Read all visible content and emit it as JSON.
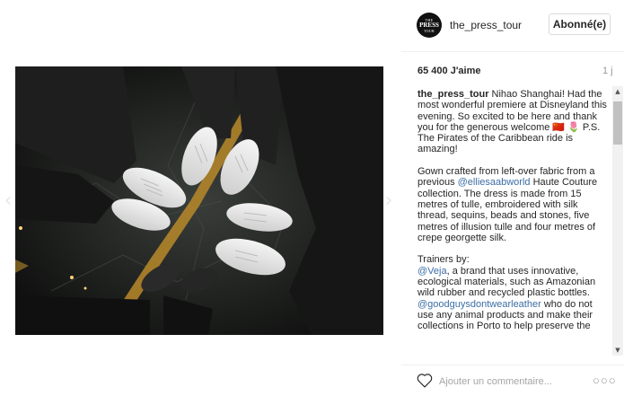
{
  "post": {
    "username": "the_press_tour",
    "follow_label": "Abonné(e)",
    "avatar_text": [
      "THE",
      "PRESS",
      "TOUR"
    ],
    "likes": "65 400 J'aime",
    "age": "1 j",
    "caption": [
      [
        {
          "t": "the_press_tour",
          "s": "user"
        },
        {
          "t": " Nihao Shanghai! Had the most wonderful premiere at Disneyland this evening. So excited to be here and thank you for the generous welcome 🇨🇳 🌷 P.S. The Pirates of the Caribbean ride is amazing!",
          "s": ""
        }
      ],
      [
        {
          "t": "Gown crafted from left-over fabric from a previous ",
          "s": ""
        },
        {
          "t": "@elliesaabworld",
          "s": "hl"
        },
        {
          "t": " Haute Couture collection. The dress is made from 15 metres of tulle, embroidered with silk thread, sequins, beads and stones, five metres of illusion tulle and four metres of crepe georgette silk.",
          "s": ""
        }
      ],
      [
        {
          "t": "Trainers by:",
          "s": "",
          "br": true
        },
        {
          "t": "@Veja",
          "s": "hl"
        },
        {
          "t": ", a brand that uses innovative, ecological materials, such as Amazonian wild rubber and recycled plastic bottles.",
          "s": "",
          "br": true
        },
        {
          "t": "@goodguysdontwearleather",
          "s": "hl"
        },
        {
          "t": " who do not use any animal products and make their collections in Porto to help preserve the",
          "s": ""
        }
      ]
    ],
    "comment_placeholder": "Ajouter un commentaire...",
    "more_label": "○○○"
  },
  "icons": {
    "prev": "‹",
    "next": "›",
    "scroll_up": "▲",
    "scroll_down": "▼"
  }
}
